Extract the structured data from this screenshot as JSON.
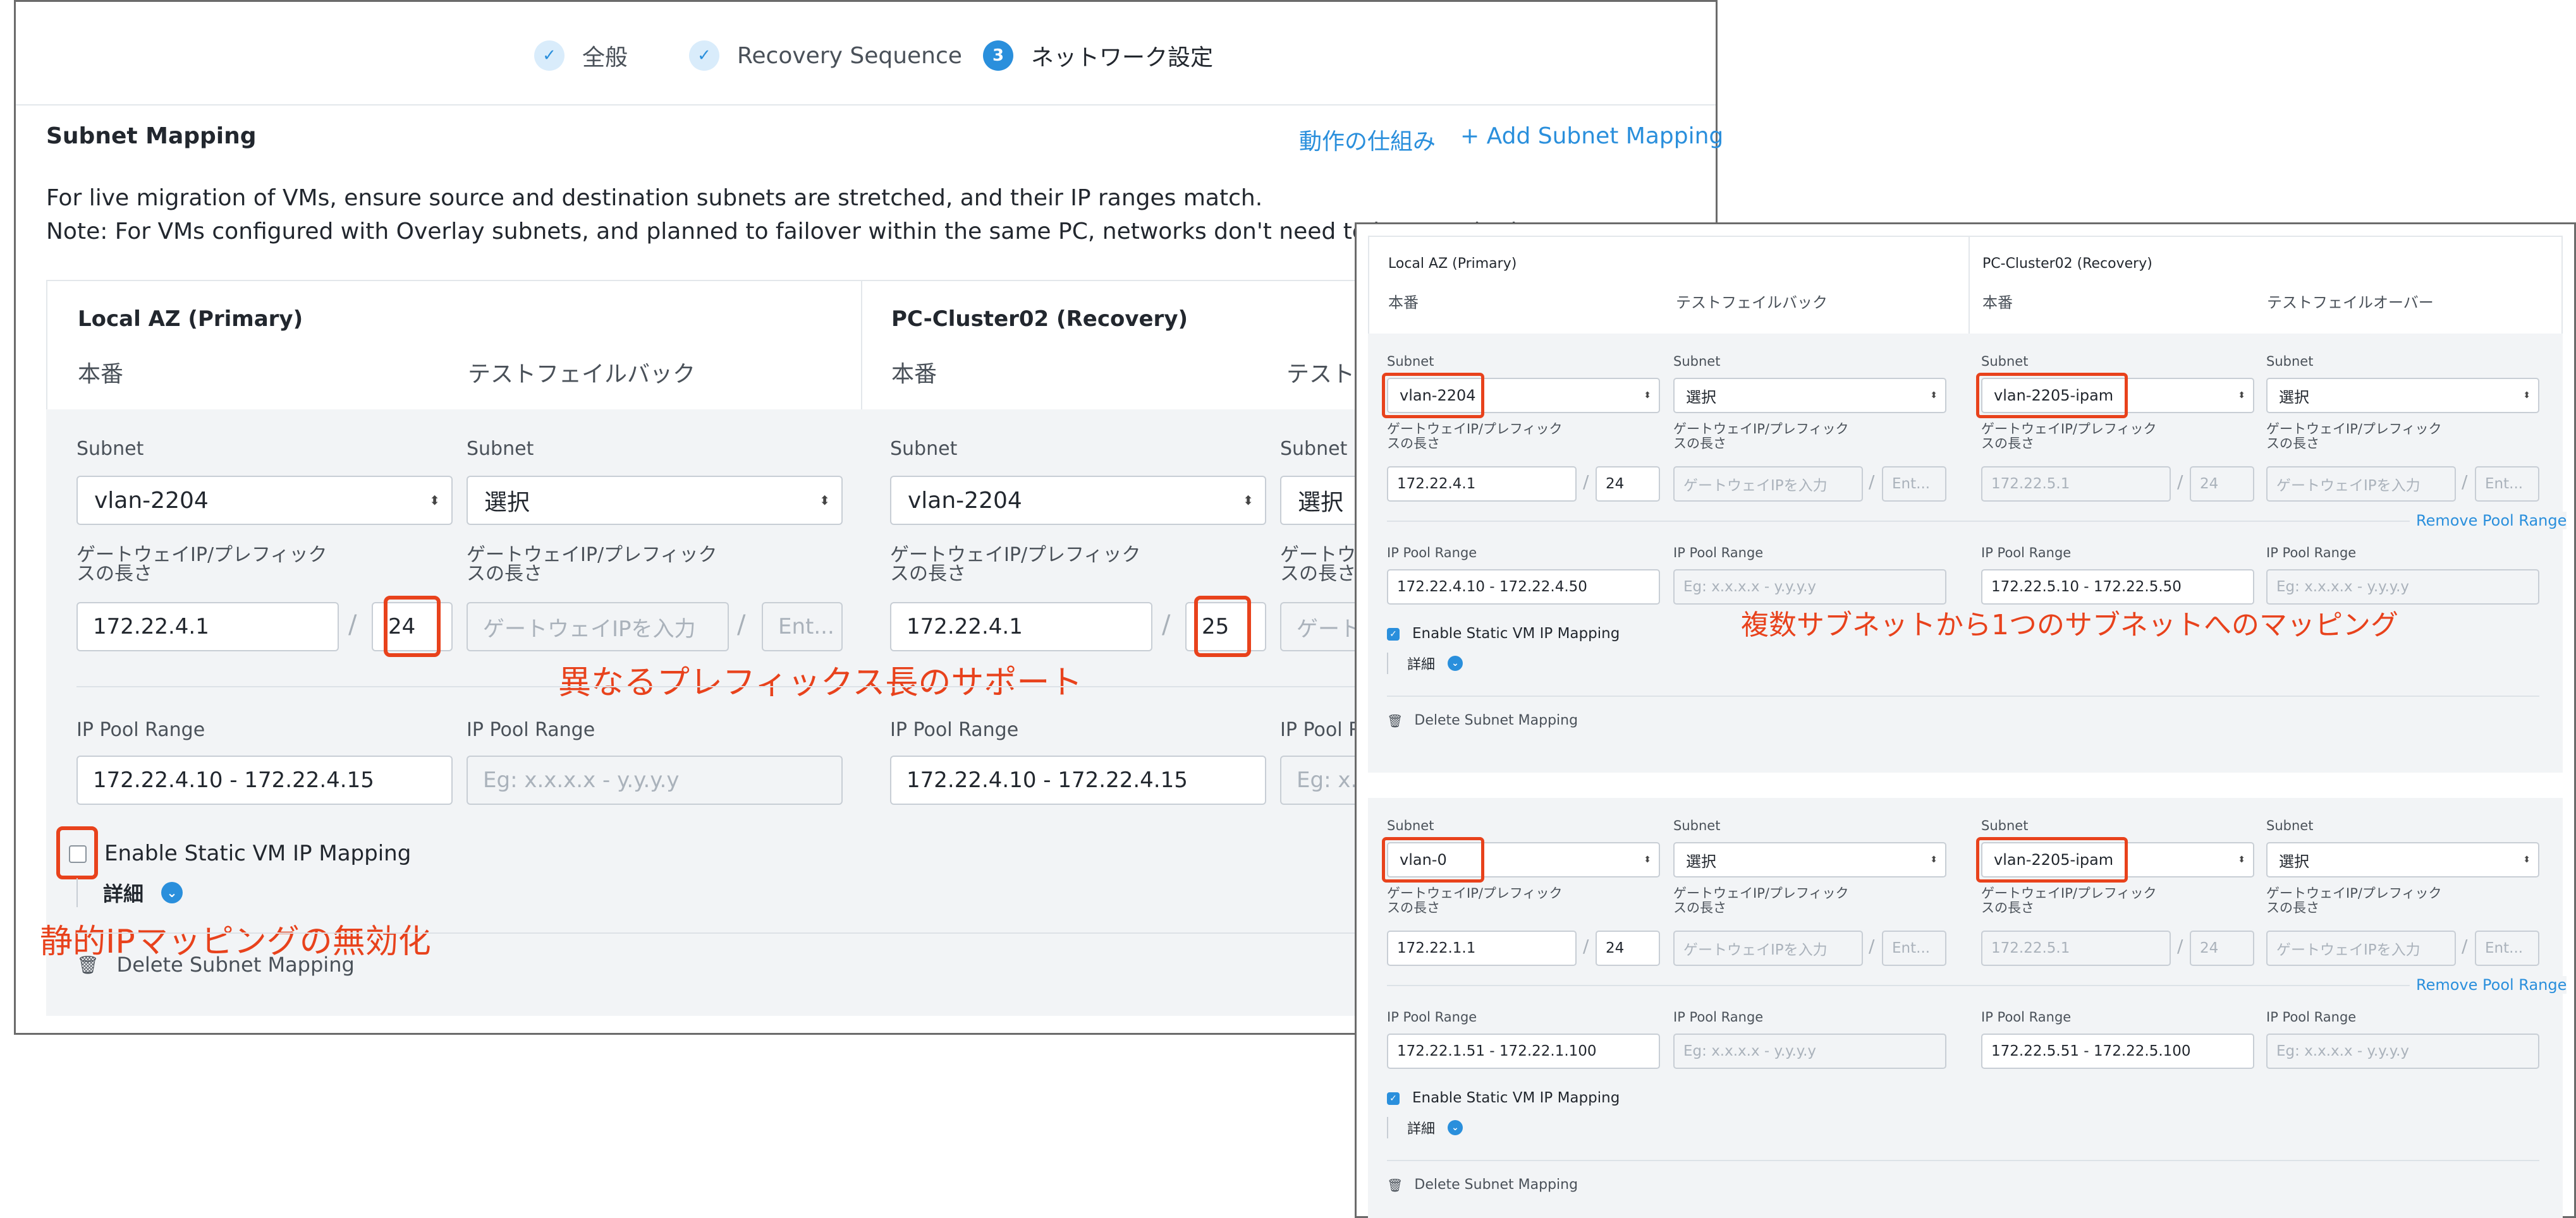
{
  "wizard": {
    "steps": [
      {
        "label": "全般",
        "state": "done",
        "marker": "✓"
      },
      {
        "label": "Recovery Sequence",
        "state": "done",
        "marker": "✓"
      },
      {
        "label": "ネットワーク設定",
        "state": "current",
        "marker": "3"
      }
    ]
  },
  "section": {
    "title": "Subnet Mapping",
    "how_it_works_link": "動作の仕組み",
    "add_mapping_link": "+ Add Subnet Mapping",
    "note_line1": "For live migration of VMs, ensure source and destination subnets are stretched, and their IP ranges match.",
    "note_line2": "Note: For VMs configured with Overlay subnets, and planned to failover within the same PC, networks don't need to be stretched."
  },
  "labels": {
    "local_az": "Local AZ (Primary)",
    "recovery_az": "PC-Cluster02 (Recovery)",
    "production": "本番",
    "test_failback": "テストフェイルバック",
    "test_failover": "テストフェイルオーバー",
    "test_truncated": "テストフ",
    "subnet": "Subnet",
    "gateway_prefix_line1": "ゲートウェイIP/プレフィック",
    "gateway_prefix_line2": "スの長さ",
    "gateway_truncated": "ゲートウ",
    "gateway_truncated2": "スの長さ",
    "ip_pool_range": "IP Pool Range",
    "ip_pool_truncated": "IP Pool Ra",
    "enable_static": "Enable Static VM IP Mapping",
    "details": "詳細",
    "delete_mapping": "Delete Subnet Mapping",
    "remove_pool_range": "Remove Pool Range",
    "select": "選択",
    "gateway_placeholder": "ゲートウェイIPを入力",
    "prefix_placeholder": "Ent...",
    "pool_placeholder": "Eg: x.x.x.x - y.y.y.y",
    "pool_placeholder_trunc": "Eg: x.x.",
    "gateway_placeholder_trunc": "ゲート"
  },
  "left_mapping": {
    "primary_subnet": "vlan-2204",
    "primary_gateway": "172.22.4.1",
    "primary_prefix": "24",
    "primary_pool": "172.22.4.10 - 172.22.4.15",
    "recovery_subnet": "vlan-2204",
    "recovery_gateway": "172.22.4.1",
    "recovery_prefix": "25",
    "recovery_pool": "172.22.4.10 - 172.22.4.15",
    "static_mapping_enabled": false
  },
  "right_mappings": [
    {
      "primary_subnet": "vlan-2204",
      "primary_gateway": "172.22.4.1",
      "primary_prefix": "24",
      "primary_pool": "172.22.4.10 - 172.22.4.50",
      "recovery_subnet": "vlan-2205-ipam",
      "recovery_gateway": "172.22.5.1",
      "recovery_prefix": "24",
      "recovery_pool": "172.22.5.10 - 172.22.5.50",
      "static_mapping_enabled": true
    },
    {
      "primary_subnet": "vlan-0",
      "primary_gateway": "172.22.1.1",
      "primary_prefix": "24",
      "primary_pool": "172.22.1.51 - 172.22.1.100",
      "recovery_subnet": "vlan-2205-ipam",
      "recovery_gateway": "172.22.5.1",
      "recovery_prefix": "24",
      "recovery_pool": "172.22.5.51 - 172.22.5.100",
      "static_mapping_enabled": true
    }
  ],
  "annotations": {
    "prefix_support": "異なるプレフィックス長のサポート",
    "static_disable": "静的IPマッピングの無効化",
    "many_to_one": "複数サブネットから1つのサブネットへのマッピング"
  },
  "colors": {
    "accent": "#2a8fdc",
    "highlight": "#e8421c",
    "section_bg": "#f2f4f6"
  }
}
